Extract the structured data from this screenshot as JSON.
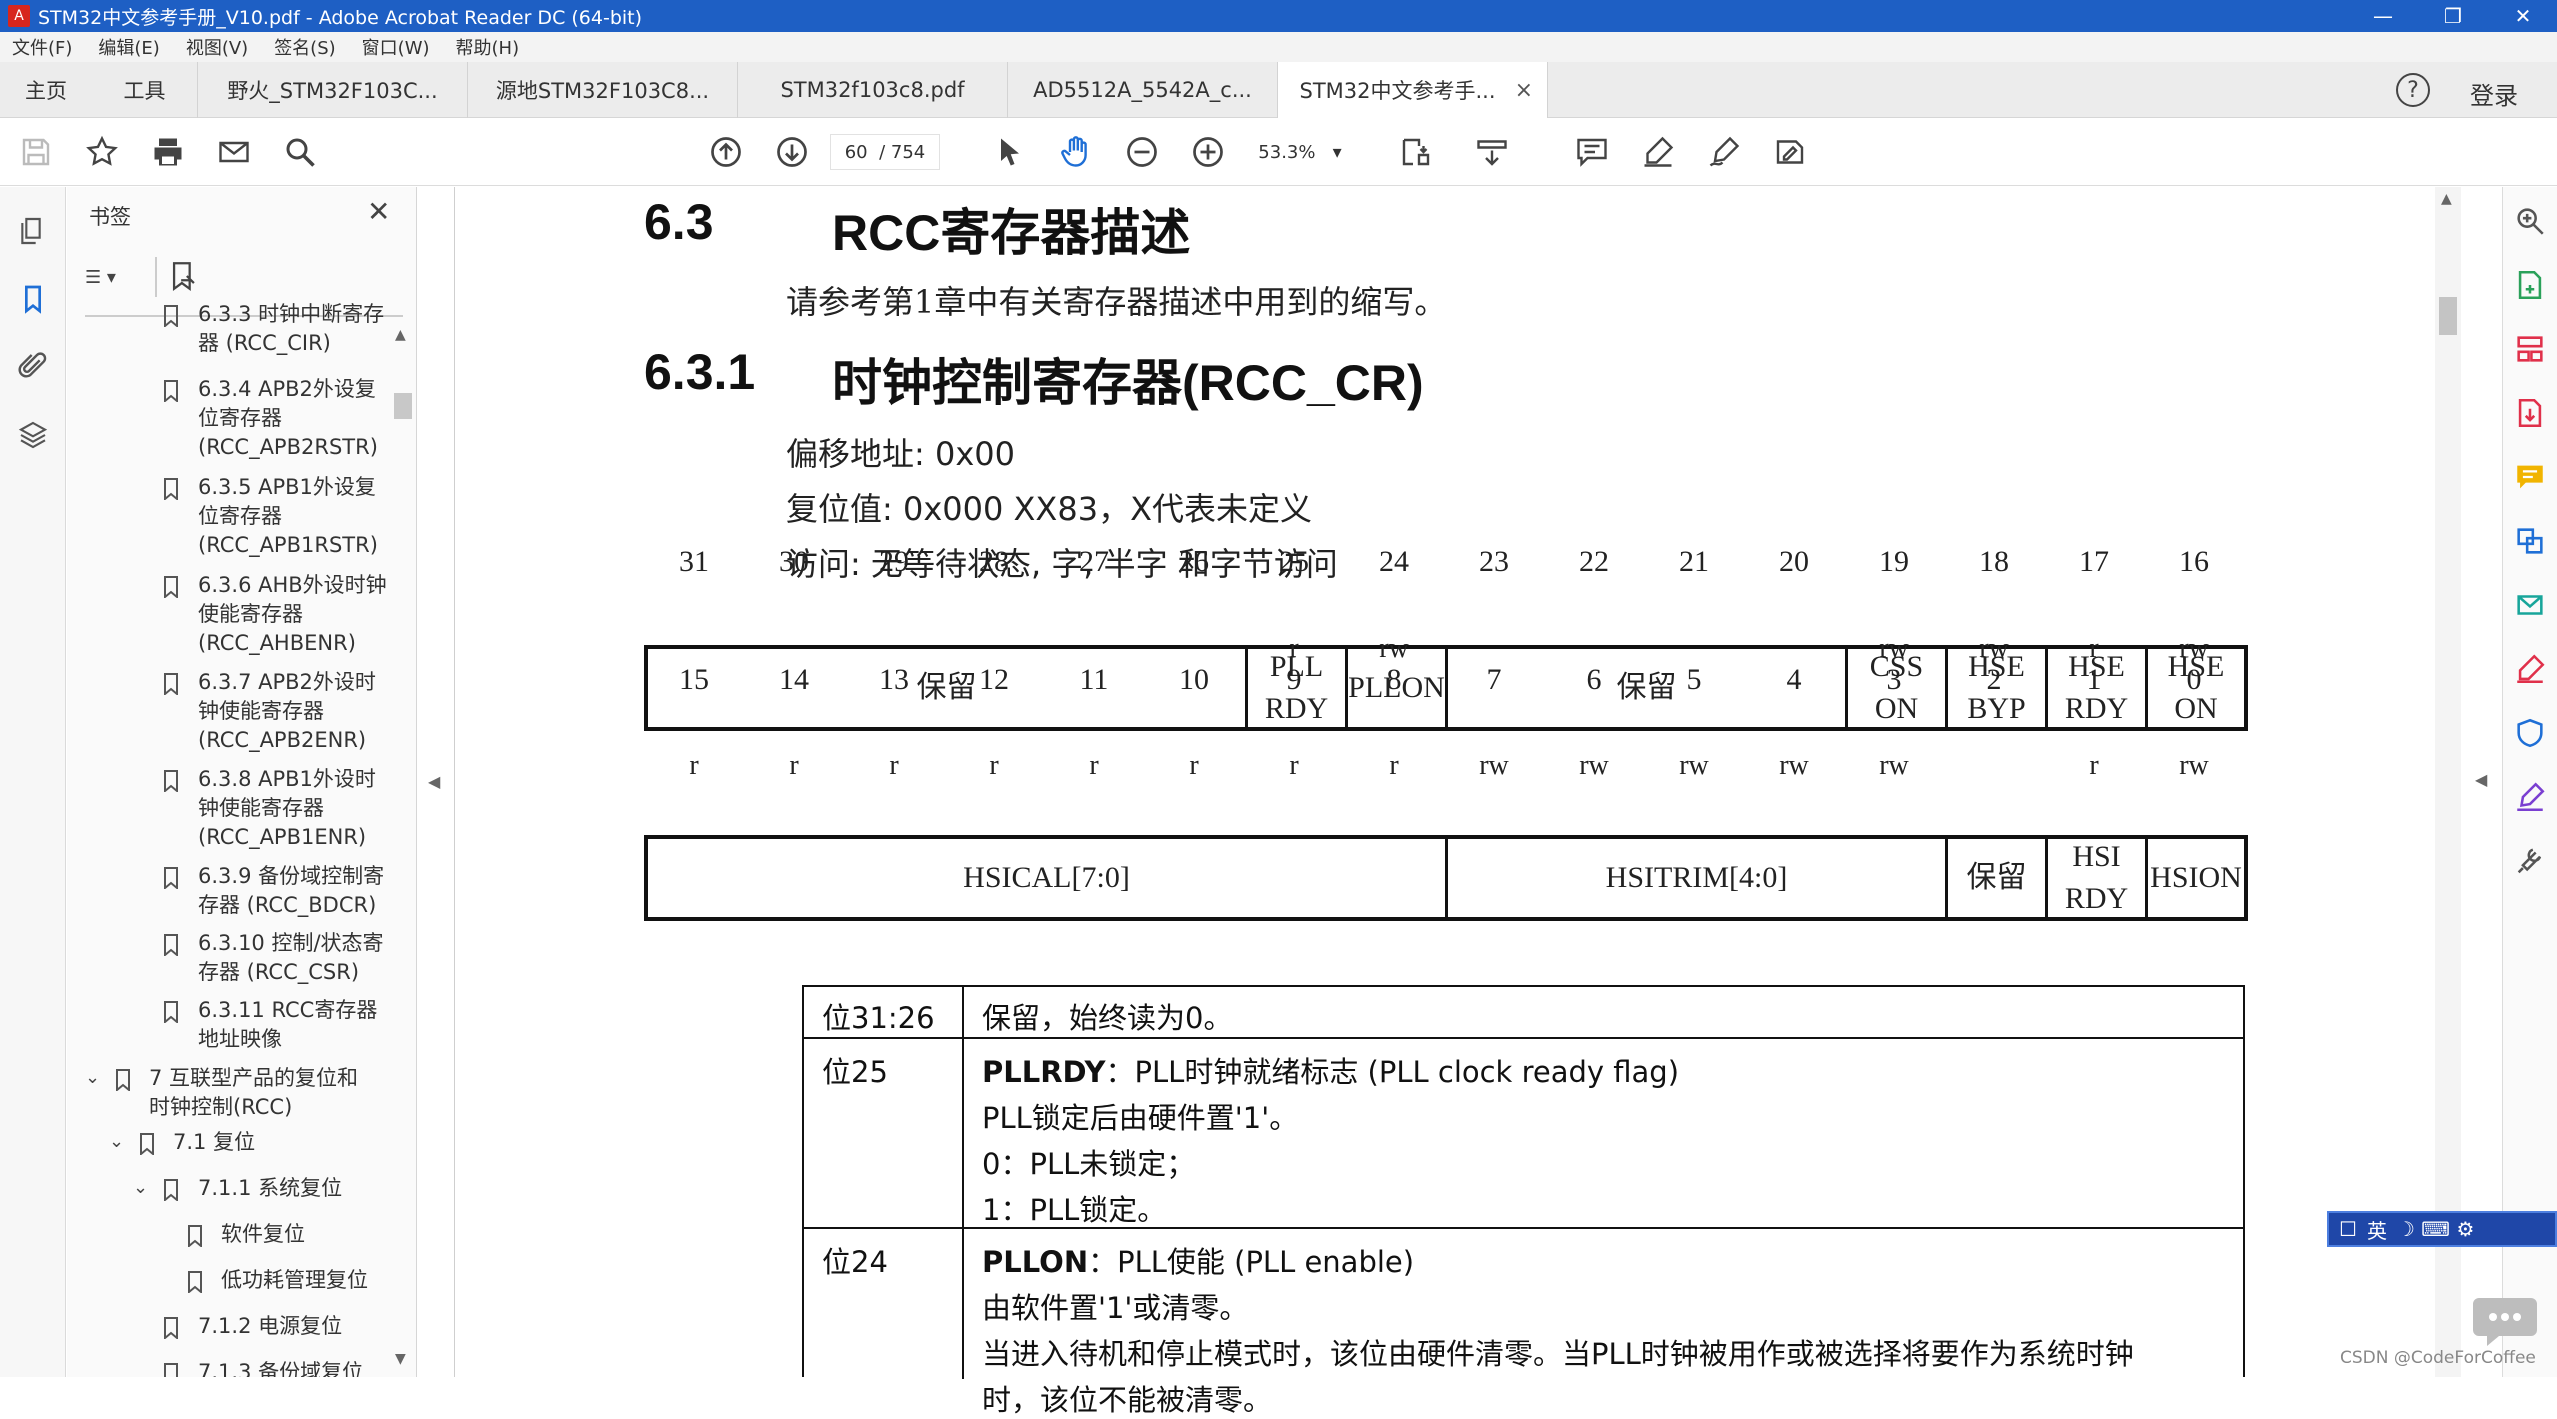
{
  "window": {
    "title": "STM32中文参考手册_V10.pdf - Adobe Acrobat Reader DC (64-bit)",
    "controls": [
      "—",
      "❐",
      "✕"
    ]
  },
  "menu": [
    "文件(F)",
    "编辑(E)",
    "视图(V)",
    "签名(S)",
    "窗口(W)",
    "帮助(H)"
  ],
  "tabs": {
    "home": "主页",
    "tools": "工具",
    "documents": [
      "野火_STM32F103C...",
      "源地STM32F103C8...",
      "STM32f103c8.pdf",
      "AD5512A_5542A_c...",
      "STM32中文参考手..."
    ],
    "help_icon": "?",
    "login": "登录"
  },
  "toolbar": {
    "page_current": "60",
    "page_total": "/ 754",
    "zoom": "53.3%"
  },
  "bookmarks": {
    "title": "书签",
    "items": [
      {
        "line1": "6.3.3 时钟中断寄存",
        "line2": "器 (RCC_CIR)"
      },
      {
        "line1": "6.3.4 APB2外设复",
        "line2": "位寄存器",
        "line3": "(RCC_APB2RSTR)"
      },
      {
        "line1": "6.3.5 APB1外设复",
        "line2": "位寄存器",
        "line3": "(RCC_APB1RSTR)"
      },
      {
        "line1": "6.3.6 AHB外设时钟",
        "line2": "使能寄存器",
        "line3": "(RCC_AHBENR)"
      },
      {
        "line1": "6.3.7 APB2外设时",
        "line2": "钟使能寄存器",
        "line3": "(RCC_APB2ENR)"
      },
      {
        "line1": "6.3.8 APB1外设时",
        "line2": "钟使能寄存器",
        "line3": "(RCC_APB1ENR)"
      },
      {
        "line1": "6.3.9 备份域控制寄",
        "line2": "存器 (RCC_BDCR)"
      },
      {
        "line1": "6.3.10 控制/状态寄",
        "line2": "存器 (RCC_CSR)"
      },
      {
        "line1": "6.3.11 RCC寄存器",
        "line2": "地址映像"
      },
      {
        "line1": "7 互联型产品的复位和",
        "line2": "时钟控制(RCC)"
      },
      {
        "line1": "7.1 复位"
      },
      {
        "line1": "7.1.1 系统复位"
      },
      {
        "line1": "软件复位"
      },
      {
        "line1": "低功耗管理复位"
      },
      {
        "line1": "7.1.2 电源复位"
      },
      {
        "line1": "7.1.3 备份域复位"
      }
    ]
  },
  "doc": {
    "h63_num": "6.3",
    "h63_title": "RCC寄存器描述",
    "intro": "请参考第1章中有关寄存器描述中用到的缩写。",
    "h631_num": "6.3.1",
    "h631_title": "时钟控制寄存器(RCC_CR)",
    "offset": "偏移地址: 0x00",
    "reset": "复位值: 0x000 XX83，X代表未定义",
    "access": "访问: 无等待状态, 字, 半字 和字节访问",
    "upper_bits": [
      "31",
      "30",
      "29",
      "28",
      "27",
      "26",
      "25",
      "24",
      "23",
      "22",
      "21",
      "20",
      "19",
      "18",
      "17",
      "16"
    ],
    "lower_bits": [
      "15",
      "14",
      "13",
      "12",
      "11",
      "10",
      "9",
      "8",
      "7",
      "6",
      "5",
      "4",
      "3",
      "2",
      "1",
      "0"
    ],
    "upper_fields": [
      {
        "l1": "保留"
      },
      {
        "l1": "PLL",
        "l2": "RDY"
      },
      {
        "l1": "PLLON"
      },
      {
        "l1": "保留"
      },
      {
        "l1": "CSS",
        "l2": "ON"
      },
      {
        "l1": "HSE",
        "l2": "BYP"
      },
      {
        "l1": "HSE",
        "l2": "RDY"
      },
      {
        "l1": "HSE",
        "l2": "ON"
      }
    ],
    "lower_fields": [
      {
        "l1": "HSICAL[7:0]"
      },
      {
        "l1": "HSITRIM[4:0]"
      },
      {
        "l1": "保留"
      },
      {
        "l1": "HSI",
        "l2": "RDY"
      },
      {
        "l1": "HSION"
      }
    ],
    "upper_access": [
      "",
      "",
      "",
      "",
      "",
      "",
      "r",
      "rw",
      "",
      "",
      "",
      "",
      "rw",
      "rw",
      "r",
      "rw"
    ],
    "lower_access": [
      "r",
      "r",
      "r",
      "r",
      "r",
      "r",
      "r",
      "r",
      "rw",
      "rw",
      "rw",
      "rw",
      "rw",
      "",
      "r",
      "rw"
    ],
    "rows": [
      {
        "bit": "位31:26",
        "lines": [
          "保留，始终读为0。"
        ]
      },
      {
        "bit": "位25",
        "head": "PLLRDY",
        "head_rest": "：PLL时钟就绪标志 (PLL clock ready flag)",
        "lines": [
          "PLL锁定后由硬件置'1'。",
          "0：PLL未锁定；",
          "1：PLL锁定。"
        ]
      },
      {
        "bit": "位24",
        "head": "PLLON",
        "head_rest": "：PLL使能 (PLL enable)",
        "lines": [
          "由软件置'1'或清零。",
          "当进入待机和停止模式时，该位由硬件清零。当PLL时钟被用作或被选择将要作为系统时钟",
          "时，该位不能被清零。"
        ]
      }
    ]
  },
  "ime": {
    "label1": "英",
    "icons": "☽ ⌨ ⚙"
  },
  "watermark": "CSDN @CodeForCoffee"
}
